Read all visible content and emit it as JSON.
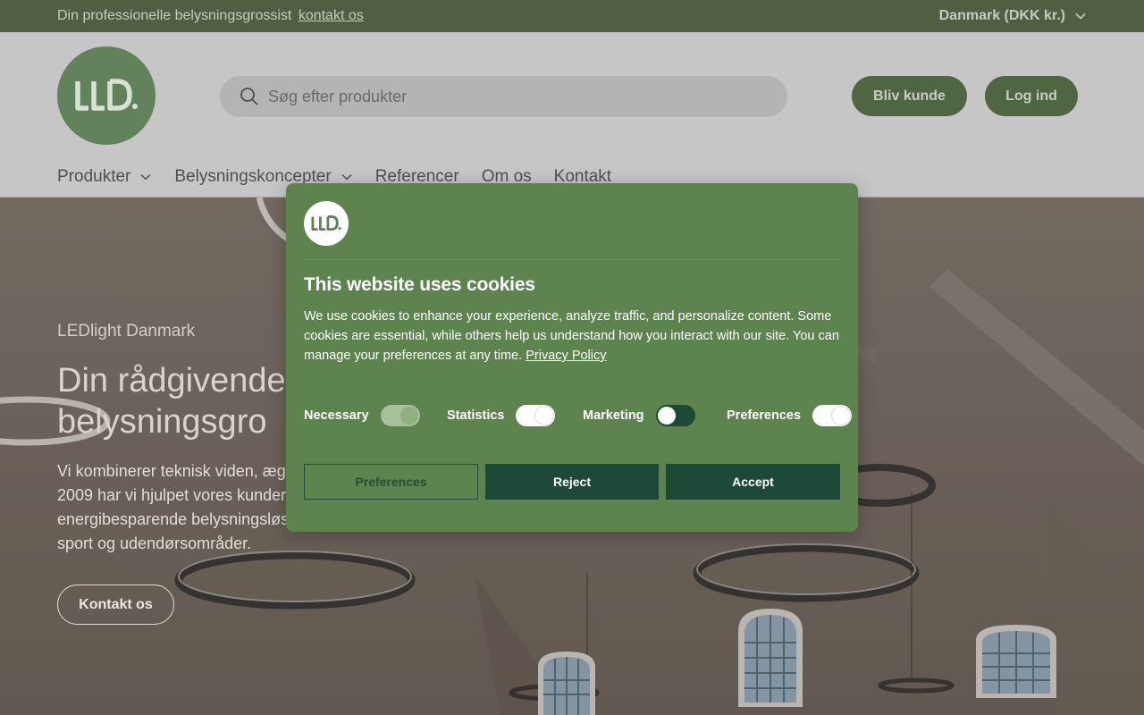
{
  "announcement": {
    "text": "Din professionelle belysningsgrossist",
    "link": "kontakt os",
    "country": "Danmark (DKK kr.)"
  },
  "header": {
    "logo_text": "LLD.",
    "search_placeholder": "Søg efter produkter",
    "join_label": "Bliv kunde",
    "login_label": "Log ind",
    "nav": [
      {
        "label": "Produkter",
        "dropdown": true
      },
      {
        "label": "Belysningskoncepter",
        "dropdown": true
      },
      {
        "label": "Referencer",
        "dropdown": false
      },
      {
        "label": "Om os",
        "dropdown": false
      },
      {
        "label": "Kontakt",
        "dropdown": false
      }
    ]
  },
  "hero": {
    "eyebrow": "LEDlight Danmark",
    "title_line1": "Din rådgivende",
    "title_line2": "belysningsgro",
    "lead_line1": "Vi kombinerer teknisk viden, ægte",
    "lead_line2": "2009 har vi hjulpet vores kunder m",
    "lead_line3": "energibesparende belysningsløsn",
    "lead_line4": "sport og udendørsområder.",
    "cta": "Kontakt os"
  },
  "cookie": {
    "logo_text": "LLD.",
    "title": "This website uses cookies",
    "description": "We use cookies to enhance your experience, analyze traffic, and personalize content. Some cookies are essential, while others help us understand how you interact with our site. You can manage your preferences at any time.",
    "privacy_link": "Privacy Policy",
    "toggles": [
      {
        "label": "Necessary",
        "state": "on",
        "disabled": true
      },
      {
        "label": "Statistics",
        "state": "on",
        "disabled": false
      },
      {
        "label": "Marketing",
        "state": "off",
        "disabled": false
      },
      {
        "label": "Preferences",
        "state": "on",
        "disabled": false
      }
    ],
    "buttons": {
      "preferences": "Preferences",
      "reject": "Reject",
      "accept": "Accept"
    }
  },
  "colors": {
    "brand_green": "#61825a",
    "topbar": "#505e42",
    "modal_bg": "#5d844f",
    "dark_button": "#1e4837"
  }
}
